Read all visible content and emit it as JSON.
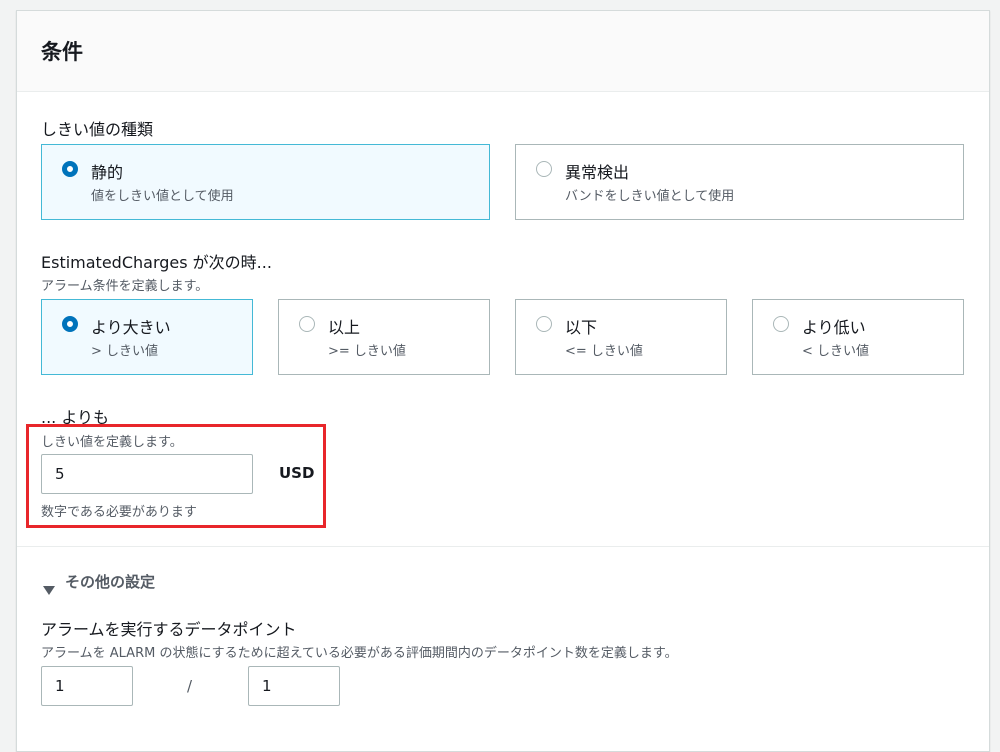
{
  "section": {
    "title": "条件"
  },
  "threshold_type": {
    "label": "しきい値の種類",
    "options": [
      {
        "label": "静的",
        "desc": "値をしきい値として使用"
      },
      {
        "label": "異常検出",
        "desc": "バンドをしきい値として使用"
      }
    ],
    "selected": "静的"
  },
  "condition": {
    "label": "EstimatedCharges が次の時...",
    "desc": "アラーム条件を定義します。",
    "options": [
      {
        "label": "より大きい",
        "desc": "> しきい値"
      },
      {
        "label": "以上",
        "desc": ">= しきい値"
      },
      {
        "label": "以下",
        "desc": "<= しきい値"
      },
      {
        "label": "より低い",
        "desc": "< しきい値"
      }
    ],
    "selected": "より大きい"
  },
  "threshold": {
    "label": "... よりも",
    "desc": "しきい値を定義します。",
    "value": "5",
    "unit": "USD",
    "hint": "数字である必要があります"
  },
  "additional": {
    "toggle_label": "その他の設定",
    "datapoints_label": "アラームを実行するデータポイント",
    "datapoints_desc": "アラームを ALARM の状態にするために超えている必要がある評価期間内のデータポイント数を定義します。",
    "datapoints_value": "1",
    "separator": "/",
    "period_value": "1"
  },
  "colors": {
    "selected_border": "#44b9d6",
    "selected_bg": "#f1faff",
    "radio_checked": "#0073bb",
    "annotation_red": "#e8262a"
  }
}
